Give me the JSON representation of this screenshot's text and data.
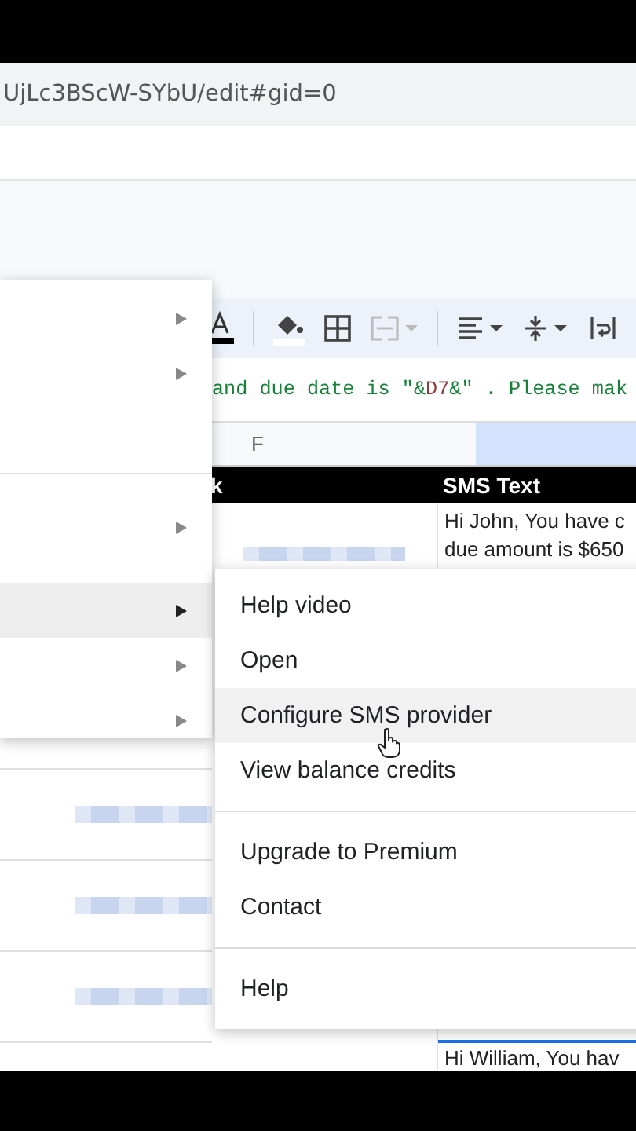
{
  "url": "UjLc3BScW-SYbU/edit#gid=0",
  "formula": [
    {
      "kind": "string",
      "text": "and due date is \"&"
    },
    {
      "kind": "ref",
      "text": "D7"
    },
    {
      "kind": "string",
      "text": "&\" . Please mak"
    }
  ],
  "columns": [
    {
      "label": "F",
      "selected": false
    },
    {
      "selected": true
    }
  ],
  "header_row": [
    "k",
    "SMS Text"
  ],
  "sms_cells": [
    [
      "Hi John, You have c",
      "due amount is $650"
    ],
    [
      "Hi William, You hav"
    ]
  ],
  "left_menu": {
    "groups": [
      [
        {
          "selected": false
        },
        {
          "selected": false
        }
      ],
      [
        {
          "selected": false
        },
        {
          "selected": true
        },
        {
          "selected": false
        },
        {
          "selected": false
        }
      ]
    ]
  },
  "submenu": {
    "groups": [
      [
        {
          "label": "Help video",
          "selected": false
        },
        {
          "label": "Open",
          "selected": false
        },
        {
          "label": "Configure SMS provider",
          "selected": true
        },
        {
          "label": "View balance credits",
          "selected": false
        }
      ],
      [
        {
          "label": "Upgrade to Premium",
          "selected": false
        },
        {
          "label": "Contact",
          "selected": false
        }
      ],
      [
        {
          "label": "Help",
          "selected": false
        }
      ]
    ]
  }
}
